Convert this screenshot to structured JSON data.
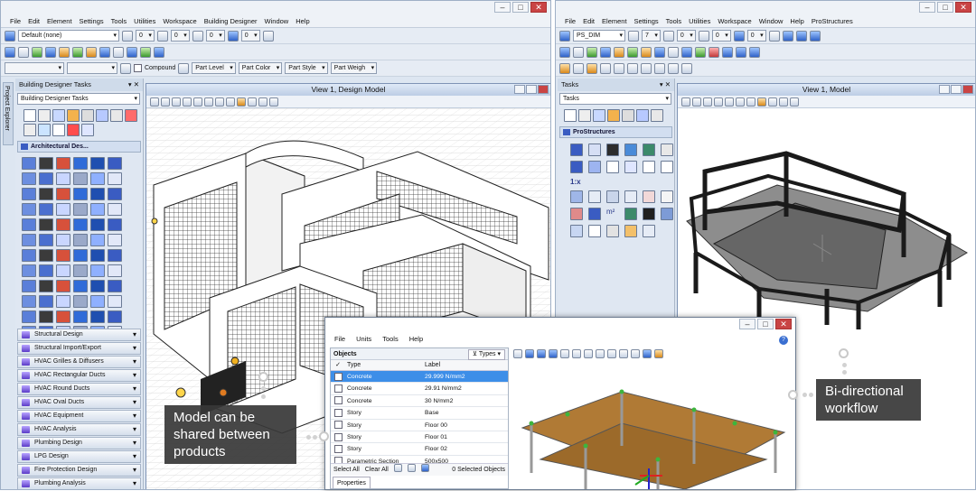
{
  "left_app": {
    "menu": [
      "File",
      "Edit",
      "Element",
      "Settings",
      "Tools",
      "Utilities",
      "Workspace",
      "Building Designer",
      "Window",
      "Help"
    ],
    "level_combo": "Default (none)",
    "toolbar_values": [
      "0",
      "0",
      "0",
      "0"
    ],
    "compound_label": "Compound",
    "attrib_buttons": [
      "Part Level",
      "Part Color",
      "Part Style",
      "Part Weigh"
    ],
    "side_tab": "Project Explorer",
    "panel_title": "Building Designer Tasks",
    "task_combo": "Building Designer Tasks",
    "section_title": "Architectural Des...",
    "categories": [
      "Structural Design",
      "Structural Import/Export",
      "HVAC Grilles & Diffusers",
      "HVAC Rectangular Ducts",
      "HVAC Round Ducts",
      "HVAC Oval Ducts",
      "HVAC Equipment",
      "HVAC Analysis",
      "Plumbing Design",
      "LPG Design",
      "Fire Protection Design",
      "Plumbing Analysis"
    ],
    "view_title": "View 1, Design Model"
  },
  "right_app": {
    "menu": [
      "File",
      "Edit",
      "Element",
      "Settings",
      "Tools",
      "Utilities",
      "Workspace",
      "Window",
      "Help",
      "ProStructures"
    ],
    "level_combo": "PS_DIM",
    "toolbar_values": [
      "7",
      "0",
      "0",
      "0"
    ],
    "panel_title": "Tasks",
    "task_combo": "Tasks",
    "section_title": "ProStructures",
    "scale_label": "1:x",
    "area_label": "m²",
    "view_title": "View 1, Model"
  },
  "dialog": {
    "menu": [
      "File",
      "Units",
      "Tools",
      "Help"
    ],
    "objects_title": "Objects",
    "types_button": "Types",
    "col_type": "Type",
    "col_label": "Label",
    "rows": [
      {
        "type": "Concrete",
        "label": "29.999 N/mm2",
        "selected": true
      },
      {
        "type": "Concrete",
        "label": "29.91 N/mm2",
        "selected": false
      },
      {
        "type": "Concrete",
        "label": "30 N/mm2",
        "selected": false
      },
      {
        "type": "Story",
        "label": "Base",
        "selected": false
      },
      {
        "type": "Story",
        "label": "Floor 00",
        "selected": false
      },
      {
        "type": "Story",
        "label": "Floor 01",
        "selected": false
      },
      {
        "type": "Story",
        "label": "Floor 02",
        "selected": false
      },
      {
        "type": "Parametric Section",
        "label": "500x500",
        "selected": false
      }
    ],
    "select_all": "Select All",
    "clear_all": "Clear All",
    "selected_count": "0 Selected Objects",
    "properties_tab": "Properties"
  },
  "callouts": {
    "left": "Model can be shared between products",
    "right": "Bi-directional workflow"
  }
}
